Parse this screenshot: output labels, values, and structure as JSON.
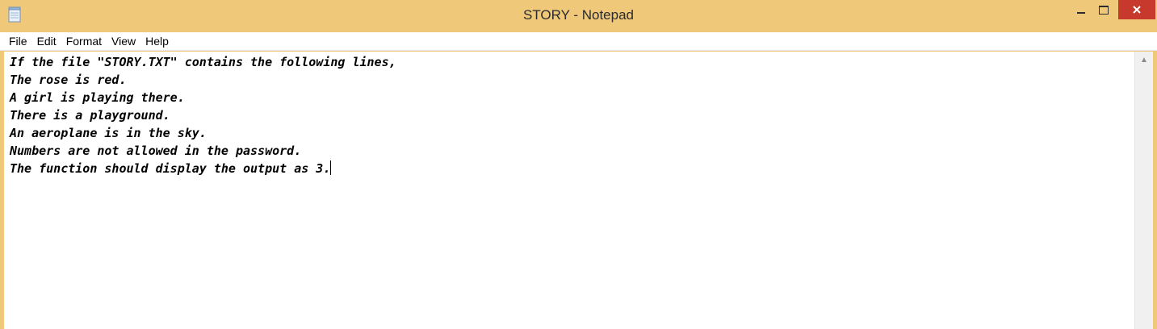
{
  "window": {
    "title": "STORY - Notepad",
    "colors": {
      "frame": "#f0c87a",
      "close_button": "#c7392c",
      "editor_bg": "#ffffff"
    },
    "icons": {
      "app": "notepad-icon",
      "minimize": "minimize-icon",
      "maximize": "maximize-icon",
      "close": "close-icon",
      "scroll_up": "chevron-up-icon"
    }
  },
  "menu": {
    "file": "File",
    "edit": "Edit",
    "format": "Format",
    "view": "View",
    "help": "Help"
  },
  "editor": {
    "lines": [
      "If the file \"STORY.TXT\" contains the following lines,",
      "The rose is red.",
      "A girl is playing there.",
      "There is a playground.",
      "An aeroplane is in the sky.",
      "Numbers are not allowed in the password.",
      "The function should display the output as 3."
    ]
  }
}
